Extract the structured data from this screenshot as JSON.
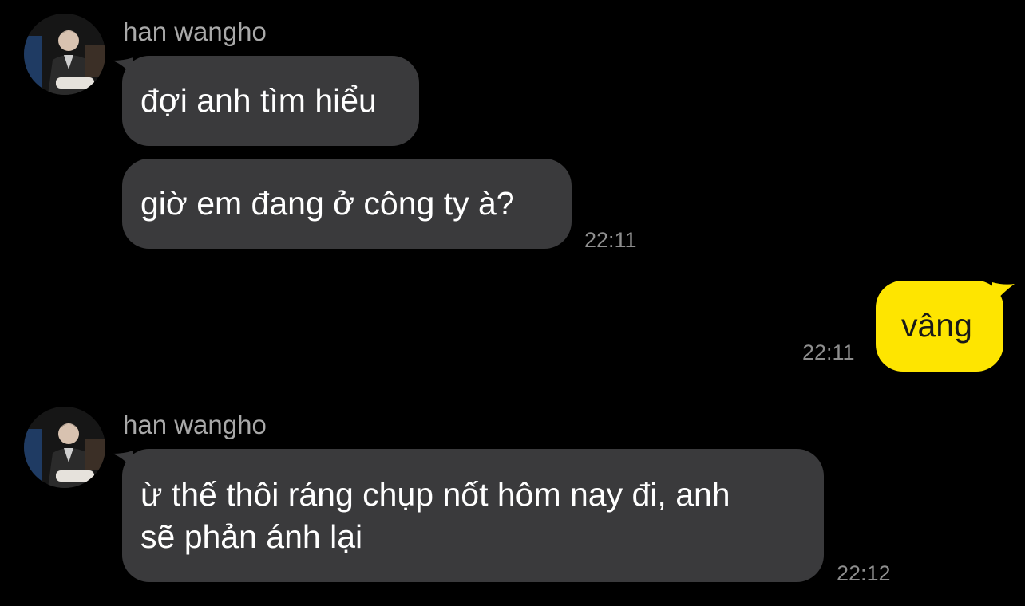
{
  "colors": {
    "background": "#000000",
    "incoming_bubble": "#3a3a3c",
    "outgoing_bubble": "#fee500",
    "sender_name": "#a9a9a9",
    "timestamp": "#8e8e8e"
  },
  "messages": {
    "group1": {
      "sender": "han wangho",
      "avatar_icon": "profile-photo",
      "bubble1": "đợi anh tìm hiểu",
      "bubble2": "giờ em đang ở công ty à?",
      "time": "22:11"
    },
    "outgoing": {
      "text": "vâng",
      "time": "22:11"
    },
    "group2": {
      "sender": "han wangho",
      "avatar_icon": "profile-photo",
      "line1": "ừ thế thôi ráng chụp nốt hôm nay đi, anh",
      "line2": "sẽ phản ánh lại",
      "time": "22:12"
    }
  }
}
